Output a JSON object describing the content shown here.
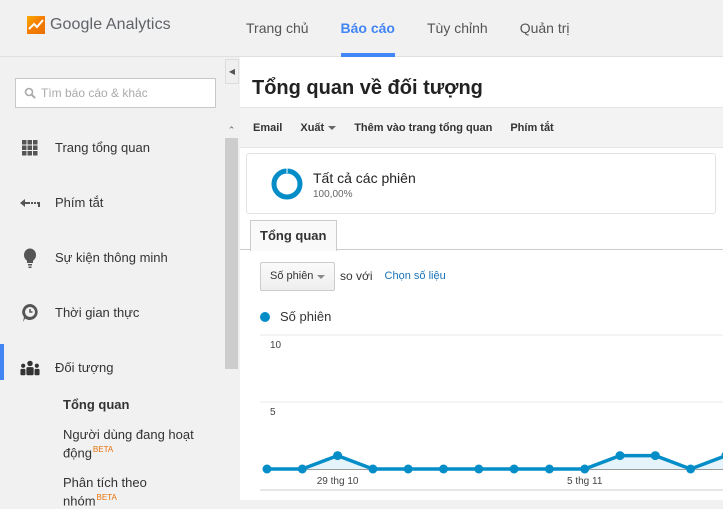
{
  "app": {
    "brand": "Google Analytics",
    "colors": {
      "accent": "#4285f4",
      "series": "#058dc7",
      "beta": "#e8710a",
      "link": "#1a73b8"
    }
  },
  "topnav": {
    "items": [
      {
        "label": "Trang chủ",
        "active": false
      },
      {
        "label": "Báo cáo",
        "active": true
      },
      {
        "label": "Tùy chỉnh",
        "active": false
      },
      {
        "label": "Quản trị",
        "active": false
      }
    ]
  },
  "sidebar": {
    "search_placeholder": "Tìm báo cáo & khác",
    "items": [
      {
        "label": "Trang tổng quan",
        "icon": "grid-icon"
      },
      {
        "label": "Phím tắt",
        "icon": "shortcut-arrow-icon"
      },
      {
        "label": "Sự kiện thông minh",
        "icon": "lightbulb-icon"
      },
      {
        "label": "Thời gian thực",
        "icon": "clock-icon"
      },
      {
        "label": "Đối tượng",
        "icon": "people-icon",
        "active": true
      }
    ],
    "sub_items": [
      {
        "label": "Tổng quan",
        "bold": true
      },
      {
        "label": "Người dùng đang hoạt động",
        "beta": "BETA"
      },
      {
        "label": "Phân tích theo nhóm",
        "beta": "BETA"
      }
    ],
    "collapse_icon": "chevron-left-icon",
    "scroll_up_icon": "chevron-up-icon"
  },
  "main": {
    "title": "Tổng quan về đối tượng",
    "toolbar": {
      "email": "Email",
      "export": "Xuất",
      "add_dashboard": "Thêm vào trang tổng quan",
      "shortcut": "Phím tắt"
    },
    "segment": {
      "name": "Tất cả các phiên",
      "percent": "100,00%"
    },
    "tab": "Tổng quan",
    "metric_select": "Số phiên",
    "vs_text": "so với",
    "choose_metric": "Chọn số liệu",
    "legend_label": "Số phiên"
  },
  "chart_data": {
    "type": "line",
    "title": "",
    "series": [
      {
        "name": "Số phiên",
        "values": [
          0,
          0,
          1,
          0,
          0,
          0,
          0,
          0,
          0,
          0,
          1,
          1,
          0,
          1
        ]
      }
    ],
    "x_tick_labels": [
      {
        "index": 2,
        "label": "29 thg 10"
      },
      {
        "index": 9,
        "label": "5 thg 11"
      }
    ],
    "y_ticks": [
      5,
      10
    ],
    "ylim": [
      0,
      10
    ],
    "grid": true,
    "legend": "top-left"
  }
}
